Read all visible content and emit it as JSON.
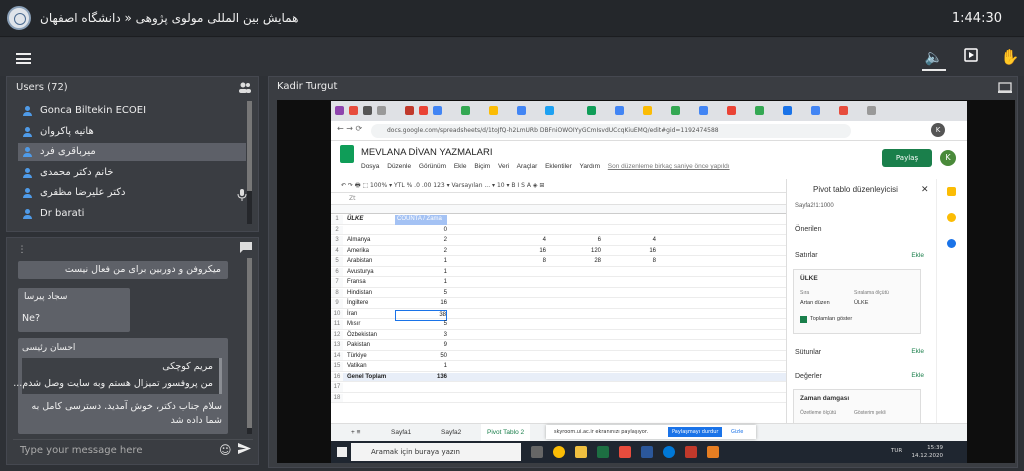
{
  "header": {
    "title": "همایش بین المللی مولوی پژوهی « دانشگاه اصفهان",
    "clock": "1:44:30"
  },
  "users": {
    "title": "Users (72)",
    "list": [
      {
        "name": "Gonca Biltekin ECOEI",
        "selected": false
      },
      {
        "name": "هانیه پاکروان",
        "selected": false
      },
      {
        "name": "میرباقری فرد",
        "selected": true
      },
      {
        "name": "خانم دکتر محمدی",
        "selected": false
      },
      {
        "name": "دکتر علیرضا مظفری",
        "selected": false
      },
      {
        "name": "Dr barati",
        "selected": false
      }
    ]
  },
  "chat": {
    "messages": [
      {
        "sender": "",
        "text": "میکروفن و دوربین برای من فعال نیست"
      },
      {
        "sender": "سجاد پیرسا",
        "text": "Ne?"
      },
      {
        "sender": "احسان رئیسی",
        "quote_sender": "مریم کوچکی",
        "quote_text": "من پروفسور تمیزال هستم وبه سایت وصل شدم...",
        "text": "سلام جناب دکتر، خوش آمدید. دسترسی کامل به شما داده شد"
      }
    ],
    "placeholder": "Type your message here"
  },
  "video": {
    "presenter": "Kadir Turgut"
  },
  "sheet": {
    "url": "docs.google.com/spreadsheets/d/1toJfQ-h2LmURb DBFniOWOIYyGCmIsvdUCcqKiuEMQ/edit#gid=1192474588",
    "title": "MEVLANA DİVAN YAZMALARI",
    "menu": [
      "Dosya",
      "Düzenle",
      "Görünüm",
      "Ekle",
      "Biçim",
      "Veri",
      "Araçlar",
      "Eklentiler",
      "Yardım",
      "Son düzenleme birkaç saniye önce yapıldı"
    ],
    "share": "Paylaş",
    "avatar": "K",
    "toolbar": "↶  ↷  🖶  ⬚   100% ▾   YTL  %  .0  .00  123 ▾    Varsayılan ... ▾    10 ▾    B  I  S  A   ◈  ⊞",
    "formula": "Zt",
    "col_header_a": "ÜLKE",
    "col_header_b": "COUNTA / Zama",
    "rows": [
      {
        "n": "1",
        "a": "ÜLKE",
        "b": "COUNTA / Zama"
      },
      {
        "n": "2",
        "a": "",
        "b": "0"
      },
      {
        "n": "3",
        "a": "Almanya",
        "b": "2",
        "c": "4",
        "d": "6",
        "e": "4"
      },
      {
        "n": "4",
        "a": "Amerika",
        "b": "2",
        "c": "16",
        "d": "120",
        "e": "16"
      },
      {
        "n": "5",
        "a": "Arabistan",
        "b": "1",
        "c": "8",
        "d": "28",
        "e": "8"
      },
      {
        "n": "6",
        "a": "Avusturya",
        "b": "1"
      },
      {
        "n": "7",
        "a": "Fransa",
        "b": "1"
      },
      {
        "n": "8",
        "a": "Hindistan",
        "b": "5"
      },
      {
        "n": "9",
        "a": "İngiltere",
        "b": "16"
      },
      {
        "n": "10",
        "a": "İran",
        "b": "38"
      },
      {
        "n": "11",
        "a": "Mısır",
        "b": "5"
      },
      {
        "n": "12",
        "a": "Özbekistan",
        "b": "3"
      },
      {
        "n": "13",
        "a": "Pakistan",
        "b": "9"
      },
      {
        "n": "14",
        "a": "Türkiye",
        "b": "50"
      },
      {
        "n": "15",
        "a": "Vatikan",
        "b": "1"
      },
      {
        "n": "16",
        "a": "Genel Toplam",
        "b": "136"
      },
      {
        "n": "17",
        "a": "",
        "b": ""
      },
      {
        "n": "18",
        "a": "",
        "b": ""
      }
    ],
    "pivot": {
      "title": "Pivot tablo düzenleyicisi",
      "range": "Sayfa2!1:1000",
      "suggest": "Önerilen",
      "rows_label": "Satırlar",
      "add": "Ekle",
      "field": "ÜLKE",
      "order_label": "Sıra",
      "order_value": "Artan düzen",
      "sort_label": "Sıralama ölçütü",
      "sort_value": "ÜLKE",
      "totals": "Toplamları göster",
      "columns_label": "Sütunlar",
      "values_label": "Değerler",
      "value_field": "Zaman damgası",
      "summarize": "Özetleme ölçütü",
      "show_as": "Gösterim şekli"
    },
    "sheet_tabs": [
      "Sayfa1",
      "Sayfa2",
      "Pivot Tablo 2"
    ],
    "notice": {
      "text": "skyroom.ui.ac.ir ekranınızı paylaşıyor.",
      "stop": "Paylaşmayı durdur",
      "hide": "Gizle"
    },
    "taskbar": {
      "search": "Aramak için buraya yazın",
      "lang": "TUR",
      "time": "15:39",
      "date": "14.12.2020"
    }
  }
}
